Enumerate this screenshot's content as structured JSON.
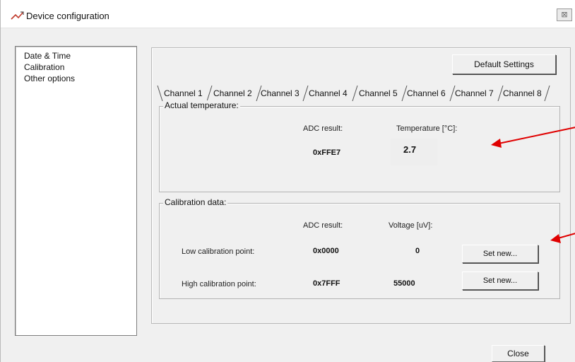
{
  "window": {
    "title": "Device configuration",
    "close_glyph": "⊠",
    "icon": "device-logo-icon"
  },
  "nav": {
    "items": [
      {
        "label": "Date & Time"
      },
      {
        "label": "Calibration"
      },
      {
        "label": "Other options"
      }
    ]
  },
  "toolbar": {
    "default_settings_label": "Default Settings"
  },
  "tabs": [
    {
      "label": "Channel 1",
      "selected": true
    },
    {
      "label": "Channel 2"
    },
    {
      "label": "Channel 3"
    },
    {
      "label": "Channel 4"
    },
    {
      "label": "Channel 5"
    },
    {
      "label": "Channel 6"
    },
    {
      "label": "Channel 7"
    },
    {
      "label": "Channel 8"
    }
  ],
  "actual": {
    "title": "Actual temperature:",
    "adc_header": "ADC result:",
    "temp_header": "Temperature [°C]:",
    "adc_value": "0xFFE7",
    "temp_value": "2.7"
  },
  "calibration": {
    "title": "Calibration data:",
    "adc_header": "ADC result:",
    "voltage_header": "Voltage [uV]:",
    "low": {
      "label": "Low calibration point:",
      "adc": "0x0000",
      "voltage": "0",
      "button": "Set new..."
    },
    "high": {
      "label": "High calibration point:",
      "adc": "0x7FFF",
      "voltage": "55000",
      "button": "Set new..."
    }
  },
  "footer": {
    "close_label": "Close"
  },
  "colors": {
    "annotation_arrow": "#e00000"
  }
}
